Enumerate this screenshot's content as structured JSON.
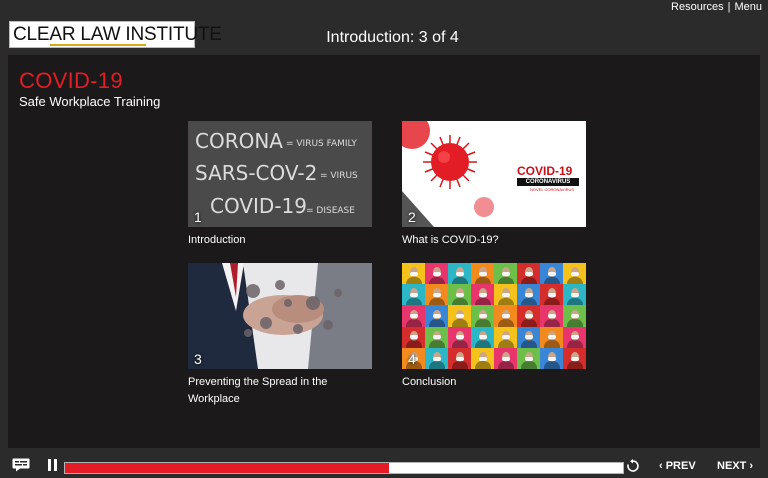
{
  "header": {
    "logo_text": "CLEAR LAW INSTITUTE",
    "title": "Introduction: 3 of 4",
    "links": {
      "resources": "Resources",
      "separator": "|",
      "menu": "Menu"
    }
  },
  "course": {
    "title": "COVID-19",
    "subtitle": "Safe Workplace Training"
  },
  "modules": [
    {
      "number": "1",
      "label": "Introduction",
      "thumb_text": [
        "CORONA",
        "= VIRUS FAMILY",
        "SARS-COV-2",
        "= VIRUS",
        "COVID-19",
        "= DISEASE"
      ]
    },
    {
      "number": "2",
      "label": "What is COVID-19?",
      "thumb_text": [
        "COVID-19",
        "CORONAVIRUS",
        "NOVEL CORONAVIRUS"
      ]
    },
    {
      "number": "3",
      "label": "Preventing the Spread in the Workplace"
    },
    {
      "number": "4",
      "label": "Conclusion"
    }
  ],
  "player": {
    "progress_fraction": 0.58,
    "prev_label": "‹ PREV",
    "next_label": "NEXT ›"
  },
  "colors": {
    "accent_red": "#e31c25",
    "header_bg": "#2b2b2b",
    "content_bg": "#1b191a",
    "logo_underline": "#d9a91a"
  },
  "icons": [
    "captions-icon",
    "pause-icon",
    "replay-icon"
  ]
}
